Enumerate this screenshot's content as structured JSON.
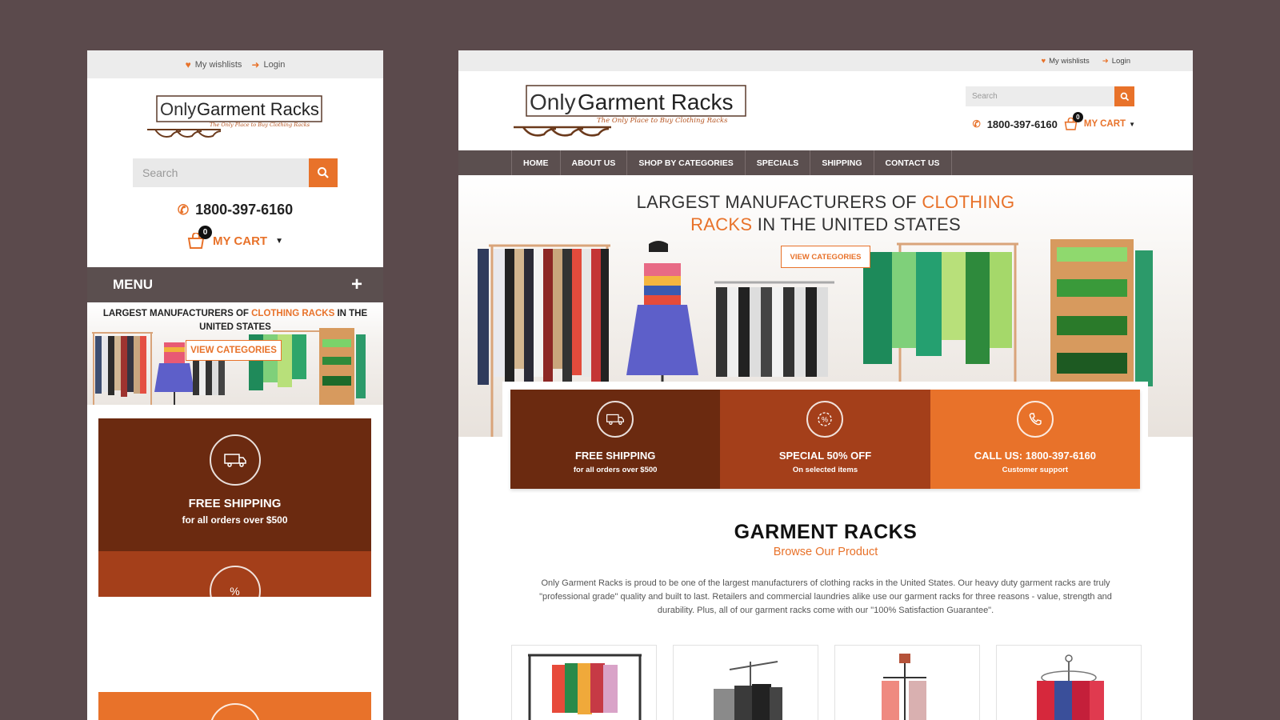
{
  "topbar": {
    "wishlist": "My wishlists",
    "login": "Login"
  },
  "logo": {
    "brand_only": "Only",
    "brand_main": "Garment Racks",
    "tagline": "The Only Place to Buy Clothing Racks"
  },
  "search": {
    "placeholder": "Search"
  },
  "contact": {
    "phone": "1800-397-6160"
  },
  "cart": {
    "label": "MY CART",
    "count": "0"
  },
  "mobile": {
    "menu_label": "MENU",
    "menu_toggle": "+"
  },
  "nav": {
    "items": [
      "HOME",
      "ABOUT US",
      "SHOP BY CATEGORIES",
      "SPECIALS",
      "SHIPPING",
      "CONTACT US"
    ]
  },
  "hero": {
    "title_part1": "LARGEST MANUFACTURERS OF ",
    "title_accent1": "CLOTHING",
    "title_accent2": "RACKS",
    "title_part2": " IN THE UNITED STATES",
    "mobile_title_part1": "LARGEST MANUFACTURERS OF ",
    "mobile_title_accent": "CLOTHING RACKS",
    "mobile_title_part2": " IN THE UNITED STATES",
    "button": "VIEW CATEGORIES"
  },
  "features": [
    {
      "title": "FREE SHIPPING",
      "subtitle": "for all orders over $500",
      "icon": "truck-icon",
      "color": "#6b2a10"
    },
    {
      "title": "SPECIAL 50% OFF",
      "subtitle": "On selected items",
      "icon": "discount-badge-icon",
      "color": "#a43f1a"
    },
    {
      "title": "CALL US: 1800-397-6160",
      "subtitle": "Customer support",
      "icon": "phone-icon",
      "color": "#e8722a"
    }
  ],
  "section": {
    "title": "GARMENT RACKS",
    "subtitle": "Browse Our Product",
    "description": "Only Garment Racks is proud to be one of the largest manufacturers of clothing racks in the United States. Our heavy duty garment racks are truly \"professional grade\" quality and built to last. Retailers and commercial laundries alike use our garment racks for three reasons - value, strength and durability. Plus, all of our garment racks come with our \"100% Satisfaction Guarantee\"."
  },
  "colors": {
    "accent": "#e8722a",
    "nav_bg": "#5b4f4f",
    "page_bg": "#5b4a4c"
  }
}
